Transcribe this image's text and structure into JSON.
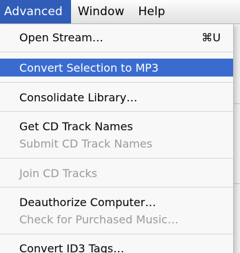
{
  "menubar": {
    "items": [
      {
        "label": "Advanced",
        "active": true
      },
      {
        "label": "Window",
        "active": false
      },
      {
        "label": "Help",
        "active": false
      }
    ]
  },
  "menu": {
    "items": [
      {
        "label": "Open Stream…",
        "shortcut": "⌘U",
        "enabled": true,
        "selected": false
      },
      {
        "label": "Convert Selection to MP3",
        "shortcut": "",
        "enabled": true,
        "selected": true
      },
      {
        "label": "Consolidate Library…",
        "shortcut": "",
        "enabled": true,
        "selected": false
      },
      {
        "label": "Get CD Track Names",
        "shortcut": "",
        "enabled": true,
        "selected": false
      },
      {
        "label": "Submit CD Track Names",
        "shortcut": "",
        "enabled": false,
        "selected": false
      },
      {
        "label": "Join CD Tracks",
        "shortcut": "",
        "enabled": false,
        "selected": false
      },
      {
        "label": "Deauthorize Computer…",
        "shortcut": "",
        "enabled": true,
        "selected": false
      },
      {
        "label": "Check for Purchased Music…",
        "shortcut": "",
        "enabled": false,
        "selected": false
      },
      {
        "label": "Convert ID3 Tags…",
        "shortcut": "",
        "enabled": true,
        "selected": false
      }
    ]
  },
  "colors": {
    "selection": "#3a6cd0",
    "menubar_active": "#2f5db8",
    "disabled_text": "#9a9a9a"
  }
}
